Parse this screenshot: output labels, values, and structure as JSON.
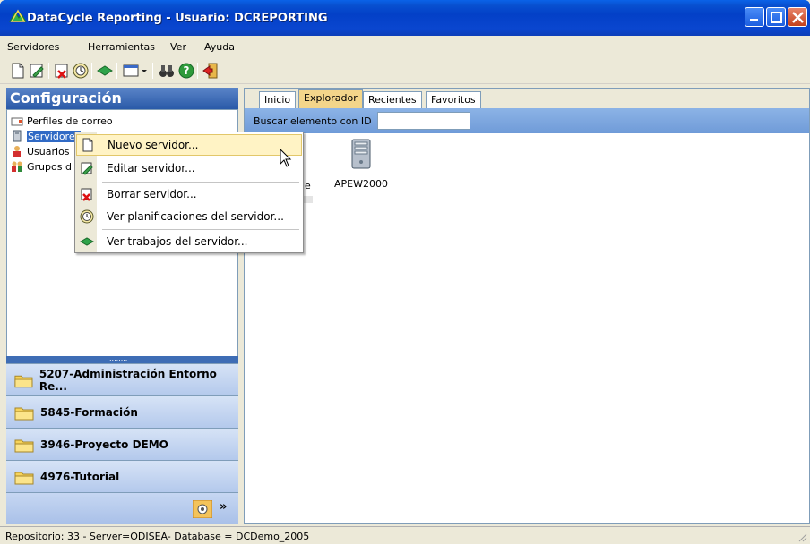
{
  "window": {
    "title": "DataCycle Reporting - Usuario: DCREPORTING"
  },
  "menubar": {
    "items": [
      {
        "label": "Servidores"
      },
      {
        "label": "Herramientas"
      },
      {
        "label": "Ver"
      },
      {
        "label": "Ayuda"
      }
    ]
  },
  "left_panel": {
    "header": "Configuración",
    "tree": [
      {
        "label": "Perfiles de correo",
        "icon": "mail-profile-icon"
      },
      {
        "label": "Servidores",
        "icon": "server-icon",
        "selected": true
      },
      {
        "label": "Usuarios",
        "icon": "users-icon"
      },
      {
        "label": "Grupos d",
        "icon": "groups-icon"
      }
    ],
    "splitter_dots": "........",
    "groups": [
      {
        "label": "5207-Administración Entorno Re..."
      },
      {
        "label": "5845-Formación"
      },
      {
        "label": "3946-Proyecto DEMO"
      },
      {
        "label": "4976-Tutorial"
      }
    ],
    "footer_chevron": "»"
  },
  "right_panel": {
    "tabs": [
      {
        "label": "Inicio"
      },
      {
        "label": "Explorador",
        "active": true
      },
      {
        "label": "Recientes"
      },
      {
        "label": "Favoritos"
      }
    ],
    "search_label": "Buscar elemento con ID",
    "search_value": "",
    "items": [
      {
        "label": "APEW2000",
        "icon": "server-icon"
      }
    ],
    "partial_label": "le"
  },
  "context_menu": {
    "items": [
      {
        "label": "Nuevo servidor...",
        "icon": "new-document-icon",
        "hovered": true
      },
      {
        "label": "Editar servidor...",
        "icon": "edit-icon"
      },
      {
        "label": "Borrar servidor...",
        "icon": "delete-icon"
      },
      {
        "label": "Ver planificaciones del servidor...",
        "icon": "clock-icon"
      },
      {
        "label": "Ver trabajos del servidor...",
        "icon": "green-arrow-icon"
      }
    ]
  },
  "statusbar": {
    "text": "Repositorio: 33 - Server=ODISEA- Database = DCDemo_2005"
  },
  "colors": {
    "title_bar": "#0340c7",
    "left_header": "#2a5aa8",
    "menu_hover": "#fff3c5",
    "active_tab": "#f3d58a",
    "search_bar": "#8cb3e6"
  }
}
